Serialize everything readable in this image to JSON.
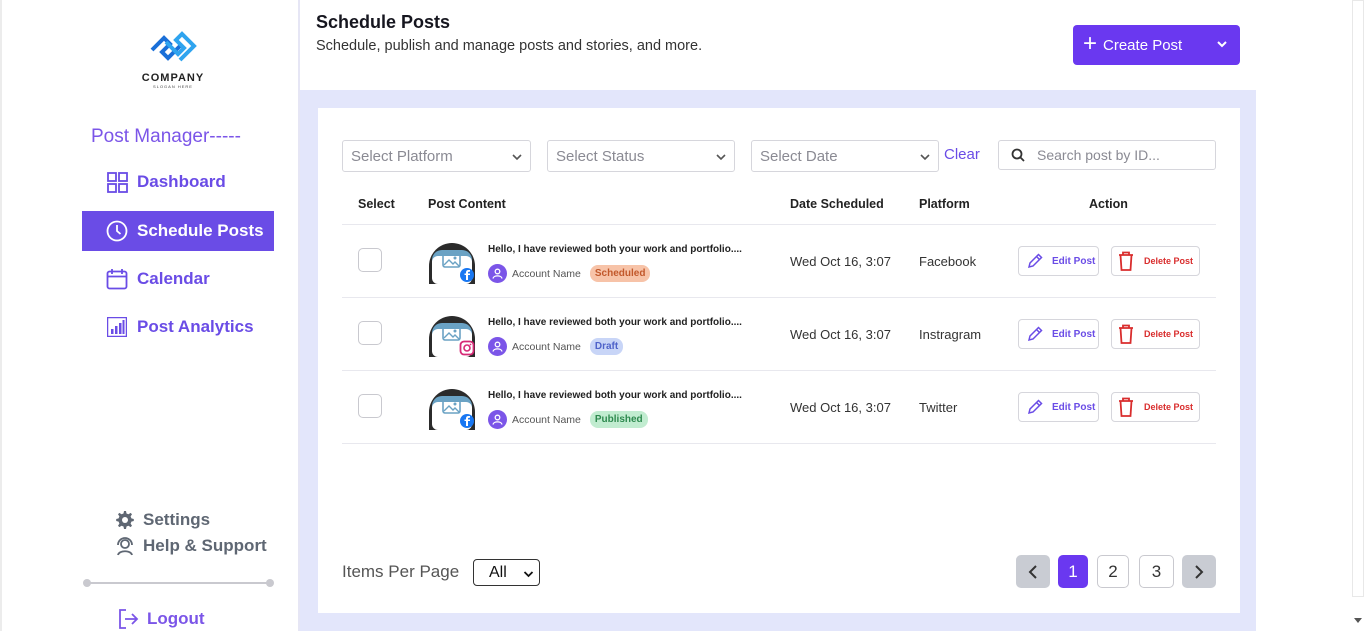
{
  "brand": {
    "name": "COMPANY",
    "slogan": "SLOGAN HERE"
  },
  "sidebar": {
    "section_title": "Post Manager-----",
    "items": [
      {
        "label": "Dashboard",
        "icon": "grid-icon"
      },
      {
        "label": "Schedule Posts",
        "icon": "clock-icon"
      },
      {
        "label": "Calendar",
        "icon": "calendar-icon"
      },
      {
        "label": "Post Analytics",
        "icon": "chart-icon"
      }
    ],
    "settings_label": "Settings",
    "help_label": "Help & Support",
    "logout_label": "Logout"
  },
  "header": {
    "title": "Schedule Posts",
    "subtitle": "Schedule, publish and manage posts and stories, and more.",
    "create_button": "Create Post"
  },
  "filters": {
    "platform_placeholder": "Select Platform",
    "status_placeholder": "Select Status",
    "date_placeholder": "Select Date",
    "clear_label": "Clear",
    "search_placeholder": "Search post by ID..."
  },
  "table": {
    "columns": [
      "Select",
      "Post Content",
      "Date Scheduled",
      "Platform",
      "Action"
    ],
    "rows": [
      {
        "content": "Hello, I have reviewed both your work and portfolio....",
        "account": "Account Name",
        "status": "Scheduled",
        "date": "Wed Oct 16, 3:07",
        "platform": "Facebook",
        "platform_icon": "facebook-icon"
      },
      {
        "content": "Hello, I have reviewed both your work and portfolio....",
        "account": "Account Name",
        "status": "Draft",
        "date": "Wed Oct 16, 3:07",
        "platform": "Instragram",
        "platform_icon": "instagram-icon"
      },
      {
        "content": "Hello, I have reviewed both your work and portfolio....",
        "account": "Account Name",
        "status": "Published",
        "date": "Wed Oct 16, 3:07",
        "platform": "Twitter",
        "platform_icon": "facebook-icon"
      }
    ],
    "edit_label": "Edit Post",
    "delete_label": "Delete Post"
  },
  "pagination": {
    "items_per_page_label": "Items Per Page",
    "items_per_page_value": "All",
    "pages": [
      "1",
      "2",
      "3"
    ],
    "current_page": "1"
  },
  "colors": {
    "accent": "#6a38f0",
    "nav_active": "#6a4ce6",
    "panel_bg": "#e3e6fb"
  }
}
